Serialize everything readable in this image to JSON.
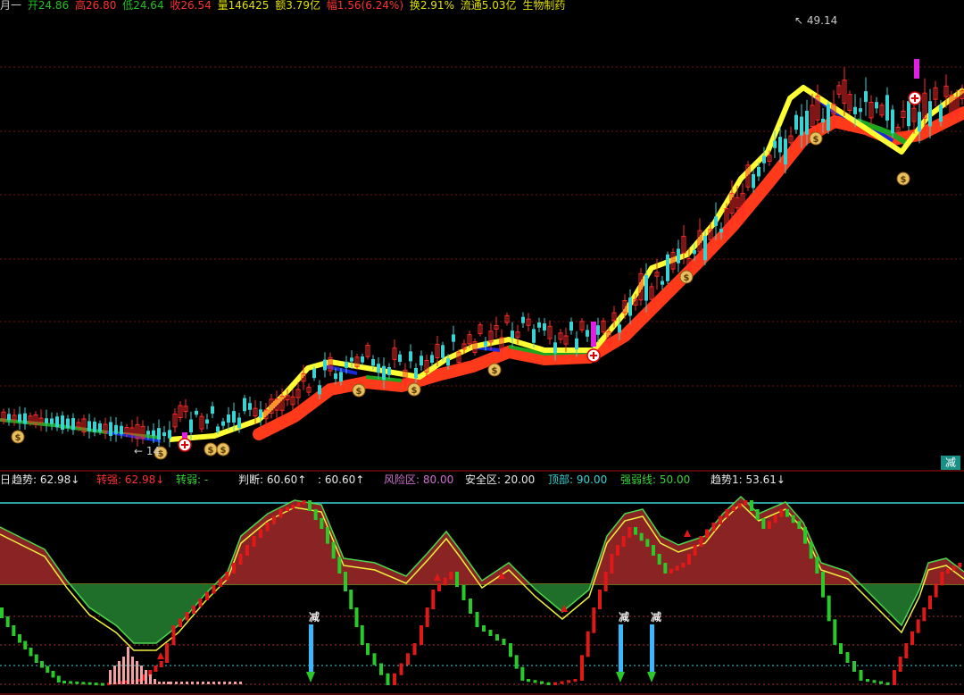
{
  "header": {
    "prefix": "月一",
    "open": "开24.86",
    "high": "高26.80",
    "low": "低24.64",
    "close": "收26.54",
    "volume": "量146425",
    "amount": "额3.79亿",
    "change": "幅1.56(6.24%)",
    "turnover": "换2.91%",
    "float": "流通5.03亿",
    "stock_name": "生物制药"
  },
  "main_chart": {
    "peak_label": "49.14",
    "low_label": "14",
    "buy_icon": "plus-circle-icon",
    "sell_icon": "money-bag-icon",
    "panel_button": "减"
  },
  "indicator": {
    "period": "日",
    "trend": "趋势: 62.98↓",
    "strong": "转强: 62.98↓",
    "weak": "转弱: -",
    "judge": "判断: 60.60↑",
    "judge2": ": 60.60↑",
    "risk_zone": "风险区: 80.00",
    "safe_zone": "安全区: 20.00",
    "top": "顶部: 90.00",
    "strong_line": "强弱线: 50.00",
    "trend1": "趋势1: 53.61↓",
    "reduce_label": "减"
  },
  "colors": {
    "up": "#ff2a2a",
    "down": "#3ad3d3",
    "yellow": "#ffff33",
    "red_ribbon": "#ff3a1a",
    "green_ribbon": "#1ea51e",
    "blue_ribbon": "#1a2ad8",
    "area_red": "#8a2424",
    "area_green": "#1f6e2a",
    "cyan_line": "#3ad3d3"
  }
}
